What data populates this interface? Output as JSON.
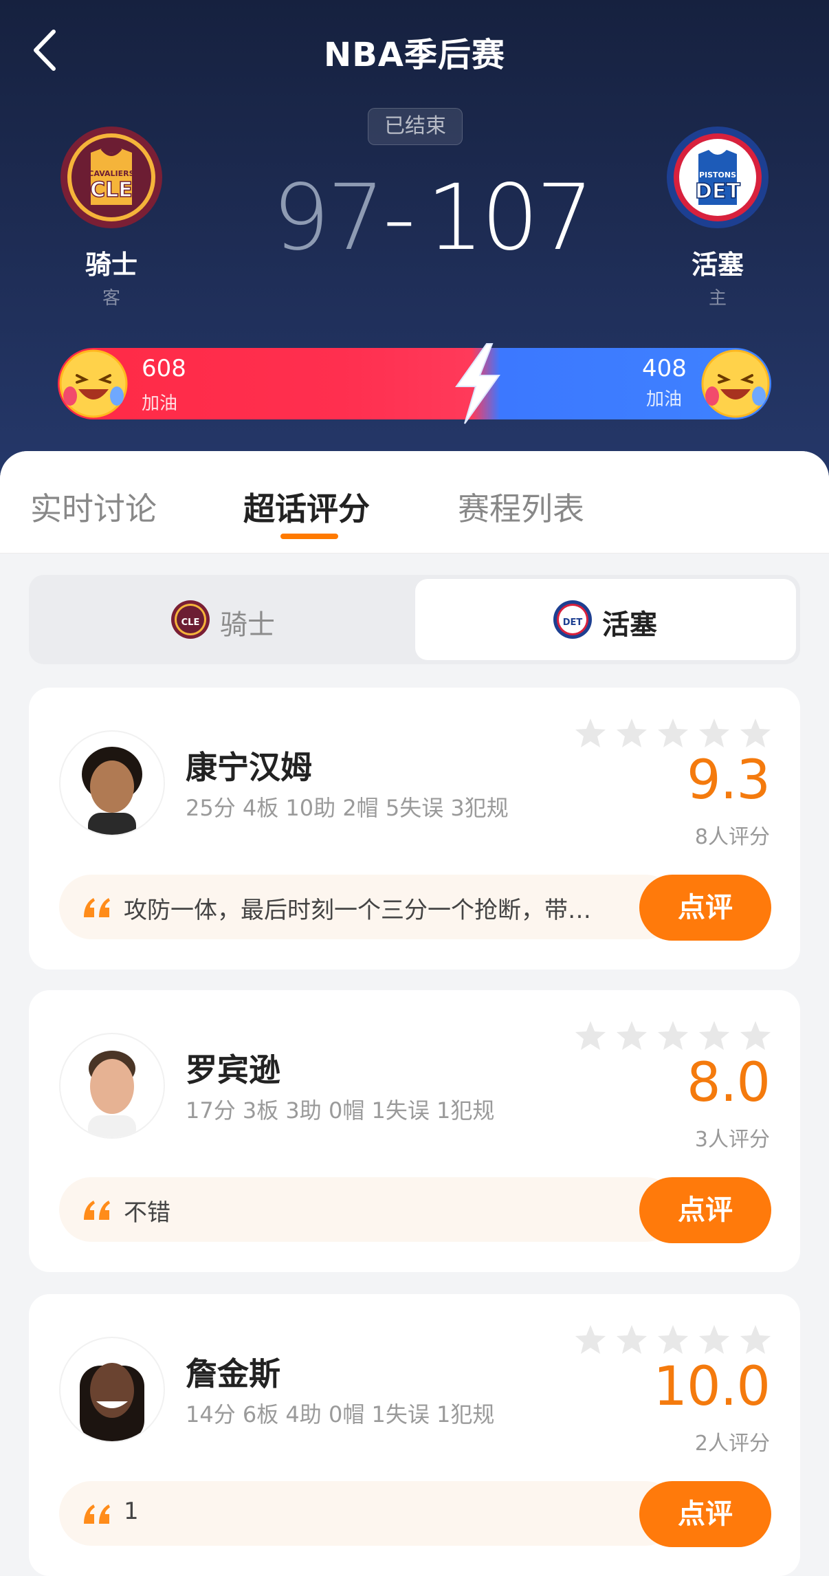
{
  "header": {
    "title": "NBA季后赛",
    "status": "已结束",
    "away": {
      "name": "骑士",
      "role": "客",
      "score": "97",
      "logo_text_top": "CAVALIERS",
      "logo_text_main": "CLE",
      "color": "#7a1f35"
    },
    "home": {
      "name": "活塞",
      "role": "主",
      "score": "107",
      "logo_text_top": "PISTONS",
      "logo_text_main": "DET",
      "color": "#1d3f91"
    },
    "separator": "-"
  },
  "cheer": {
    "away_count": "608",
    "away_label": "加油",
    "home_count": "408",
    "home_label": "加油",
    "away_color": "#ff2a46",
    "home_color": "#3f82ff"
  },
  "tabs": [
    {
      "label": "实时讨论"
    },
    {
      "label": "超话评分"
    },
    {
      "label": "赛程列表"
    }
  ],
  "team_switch": {
    "away_label": "骑士",
    "home_label": "活塞",
    "selected": "活塞"
  },
  "players": [
    {
      "name": "康宁汉姆",
      "stats": "25分 4板 10助 2帽 5失误 3犯规",
      "rating": "9.3",
      "raters": "8人评分",
      "comment": "攻防一体，最后时刻一个三分一个抢断，带…",
      "button": "点评"
    },
    {
      "name": "罗宾逊",
      "stats": "17分 3板 3助 0帽 1失误 1犯规",
      "rating": "8.0",
      "raters": "3人评分",
      "comment": "不错",
      "button": "点评"
    },
    {
      "name": "詹金斯",
      "stats": "14分 6板 4助 0帽 1失误 1犯规",
      "rating": "10.0",
      "raters": "2人评分",
      "comment": "1",
      "button": "点评"
    }
  ],
  "accent_color": "#ff7a0b"
}
